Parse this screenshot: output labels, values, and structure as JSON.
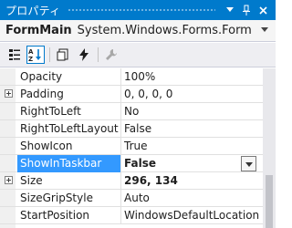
{
  "window": {
    "title": "プロパティ",
    "dropdown_icon": "dropdown-arrow-icon",
    "pin_icon": "pin-icon",
    "close_icon": "close-icon"
  },
  "object_selector": {
    "name": "FormMain",
    "type": "System.Windows.Forms.Form"
  },
  "toolbar": {
    "buttons": [
      "categorized-icon",
      "alphabetical-icon",
      "properties-icon",
      "events-icon",
      "property-pages-icon"
    ],
    "active": "alphabetical-icon"
  },
  "properties": [
    {
      "name": "Opacity",
      "value": "100%",
      "expandable": false
    },
    {
      "name": "Padding",
      "value": "0, 0, 0, 0",
      "expandable": true
    },
    {
      "name": "RightToLeft",
      "value": "No",
      "expandable": false
    },
    {
      "name": "RightToLeftLayout",
      "value": "False",
      "expandable": false
    },
    {
      "name": "ShowIcon",
      "value": "True",
      "expandable": false
    },
    {
      "name": "ShowInTaskbar",
      "value": "False",
      "expandable": false,
      "selected": true,
      "bold": true
    },
    {
      "name": "Size",
      "value": "296, 134",
      "expandable": true,
      "bold": true
    },
    {
      "name": "SizeGripStyle",
      "value": "Auto",
      "expandable": false
    },
    {
      "name": "StartPosition",
      "value": "WindowsDefaultLocation",
      "expandable": false
    }
  ],
  "colors": {
    "titlebar": "#007acc",
    "selection": "#3399ff"
  }
}
